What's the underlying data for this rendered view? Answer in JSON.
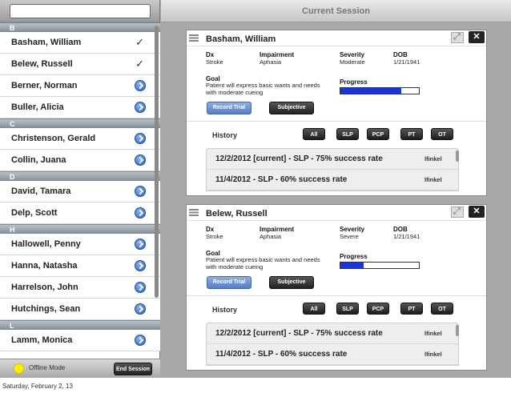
{
  "search": {
    "placeholder": ""
  },
  "sidebar": {
    "groups": [
      {
        "letter": "B",
        "items": [
          {
            "name": "Basham, William",
            "mark": "check"
          },
          {
            "name": "Belew, Russell",
            "mark": "check"
          },
          {
            "name": "Berner, Norman",
            "mark": "disclosure"
          },
          {
            "name": "Buller, Alicia",
            "mark": "disclosure"
          }
        ]
      },
      {
        "letter": "C",
        "items": [
          {
            "name": "Christenson, Gerald",
            "mark": "disclosure"
          },
          {
            "name": "Collin, Juana",
            "mark": "disclosure"
          }
        ]
      },
      {
        "letter": "D",
        "items": [
          {
            "name": "David, Tamara",
            "mark": "disclosure"
          },
          {
            "name": "Delp, Scott",
            "mark": "disclosure"
          }
        ]
      },
      {
        "letter": "H",
        "items": [
          {
            "name": "Hallowell, Penny",
            "mark": "disclosure"
          },
          {
            "name": "Hanna, Natasha",
            "mark": "disclosure"
          },
          {
            "name": "Harrelson, John",
            "mark": "disclosure"
          },
          {
            "name": "Hutchings, Sean",
            "mark": "disclosure"
          }
        ]
      },
      {
        "letter": "L",
        "items": [
          {
            "name": "Lamm, Monica",
            "mark": "disclosure"
          }
        ]
      }
    ],
    "offline_label": "Offline Mode",
    "end_session_label": "End Session"
  },
  "session": {
    "title": "Current Session",
    "labels": {
      "dx": "Dx",
      "impairment": "Impairment",
      "severity": "Severity",
      "dob": "DOB",
      "goal": "Goal",
      "progress": "Progress",
      "history": "History"
    },
    "buttons": {
      "record_trial": "Record Trial",
      "subjective": "Subjective"
    },
    "filters": [
      "All",
      "SLP",
      "PCP",
      "PT",
      "OT"
    ],
    "close_label": "✕",
    "cards": [
      {
        "name": "Basham, William",
        "dx": "Stroke",
        "impairment": "Aphasia",
        "severity": "Moderate",
        "dob": "1/21/1941",
        "goal": "Patient will express basic wants and needs with moderate cueing",
        "progress": 0.78,
        "history": [
          {
            "text": "12/2/2012 [current] - SLP - 75% success rate",
            "user": "lfinkel"
          },
          {
            "text": "11/4/2012 - SLP - 60% success rate",
            "user": "lfinkel"
          }
        ]
      },
      {
        "name": "Belew, Russell",
        "dx": "Stroke",
        "impairment": "Aphasia",
        "severity": "Severe",
        "dob": "1/21/1941",
        "goal": "Patient will express basic wants and needs with moderate cueing",
        "progress": 0.3,
        "history": [
          {
            "text": "12/2/2012 [current] - SLP - 75% success rate",
            "user": "lfinkel"
          },
          {
            "text": "11/4/2012 - SLP - 60% success rate",
            "user": "lfinkel"
          }
        ]
      }
    ]
  },
  "colors": {
    "progress_fill": "#1a35d6",
    "offline_dot": "#ffee00",
    "disclosure": "#2c5fbf"
  },
  "footer": {
    "date": "Saturday, February 2, 13"
  }
}
